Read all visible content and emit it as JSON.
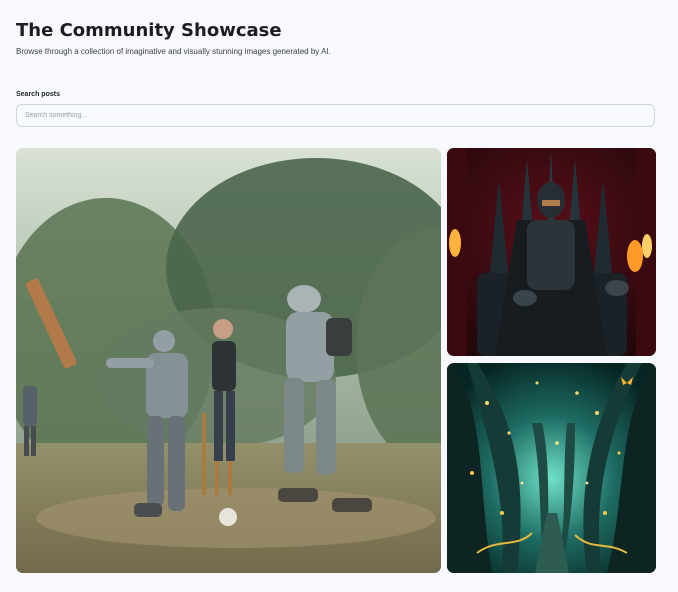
{
  "header": {
    "title": "The Community Showcase",
    "subtitle": "Browse through a collection of imaginative and visually stunning images generated by AI."
  },
  "search": {
    "label": "Search posts",
    "placeholder": "Search something...",
    "value": ""
  },
  "posts": [
    {
      "subject": "robots-playing-cricket"
    },
    {
      "subject": "armored-figure-on-dark-throne"
    },
    {
      "subject": "enchanted-forest-path"
    }
  ]
}
